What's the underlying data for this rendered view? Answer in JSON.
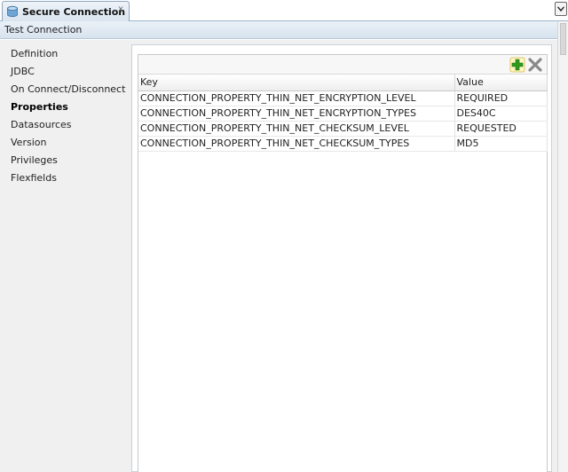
{
  "tab": {
    "label": "Secure Connection",
    "close": "x"
  },
  "titlebar": {
    "label": "Test Connection"
  },
  "nav": {
    "items": [
      {
        "label": "Definition"
      },
      {
        "label": "JDBC"
      },
      {
        "label": "On Connect/Disconnect"
      },
      {
        "label": "Properties"
      },
      {
        "label": "Datasources"
      },
      {
        "label": "Version"
      },
      {
        "label": "Privileges"
      },
      {
        "label": "Flexfields"
      }
    ],
    "active": "Properties"
  },
  "table": {
    "columns": [
      "Key",
      "Value"
    ],
    "rows": [
      [
        "CONNECTION_PROPERTY_THIN_NET_ENCRYPTION_LEVEL",
        "REQUIRED"
      ],
      [
        "CONNECTION_PROPERTY_THIN_NET_ENCRYPTION_TYPES",
        "DES40C"
      ],
      [
        "CONNECTION_PROPERTY_THIN_NET_CHECKSUM_LEVEL",
        "REQUESTED"
      ],
      [
        "CONNECTION_PROPERTY_THIN_NET_CHECKSUM_TYPES",
        "MD5"
      ]
    ]
  },
  "icons": {
    "tab": "database-icon",
    "add": "add-plus-icon",
    "delete": "delete-x-icon",
    "menu": "chevron-down-icon"
  },
  "colors": {
    "add_green": "#2e9b1e",
    "delete_gray": "#8a8a8a",
    "tab_border": "#8ea6bf"
  }
}
